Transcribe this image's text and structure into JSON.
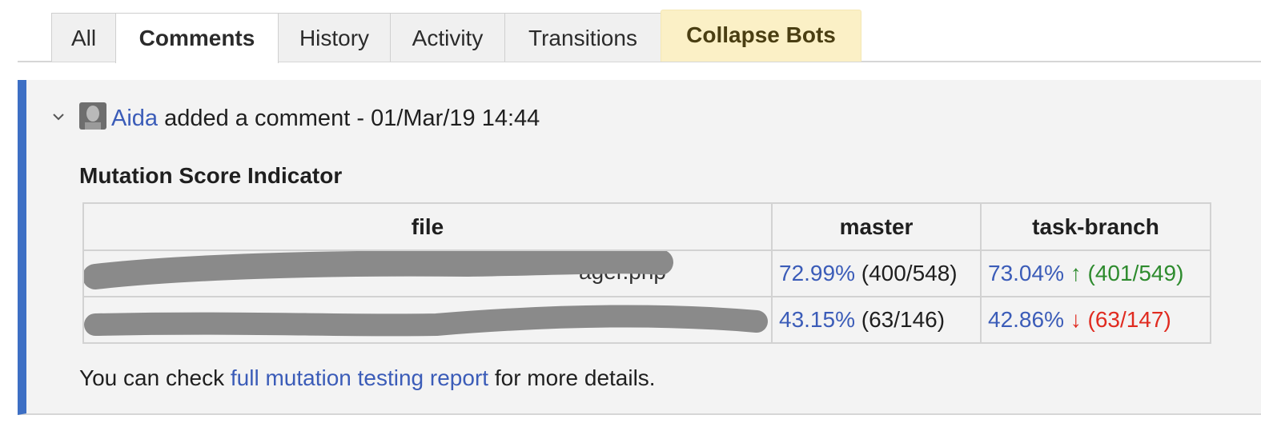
{
  "tabs": [
    {
      "label": "All"
    },
    {
      "label": "Comments"
    },
    {
      "label": "History"
    },
    {
      "label": "Activity"
    },
    {
      "label": "Transitions"
    },
    {
      "label": "Collapse Bots"
    }
  ],
  "active_tab": "Comments",
  "comment": {
    "author": "Aida",
    "action": "added a comment",
    "separator": "-",
    "timestamp": "01/Mar/19 14:44",
    "heading": "Mutation Score Indicator",
    "table": {
      "headers": [
        "file",
        "master",
        "task-branch"
      ],
      "rows": [
        {
          "file_visible_start": "_",
          "file_visible_end": "ager.php",
          "master_pct": "72.99%",
          "master_counts": "(400/548)",
          "branch_pct": "73.04%",
          "branch_arrow": "↑",
          "branch_counts": "(401/549)",
          "trend": "up"
        },
        {
          "file_visible_start": "_",
          "file_visible_end": "",
          "master_pct": "43.15%",
          "master_counts": "(63/146)",
          "branch_pct": "42.86%",
          "branch_arrow": "↓",
          "branch_counts": "(63/147)",
          "trend": "down"
        }
      ]
    },
    "footer_prefix": "You can check",
    "footer_link": "full mutation testing report",
    "footer_suffix": "for more details."
  },
  "colors": {
    "accent_bar": "#3d6fc4",
    "link": "#3b5cb8",
    "up": "#2e8b2e",
    "down": "#e02b20",
    "bot_tab": "#fbf0c6"
  },
  "icons": [
    "chevron-down-icon",
    "avatar-image"
  ]
}
